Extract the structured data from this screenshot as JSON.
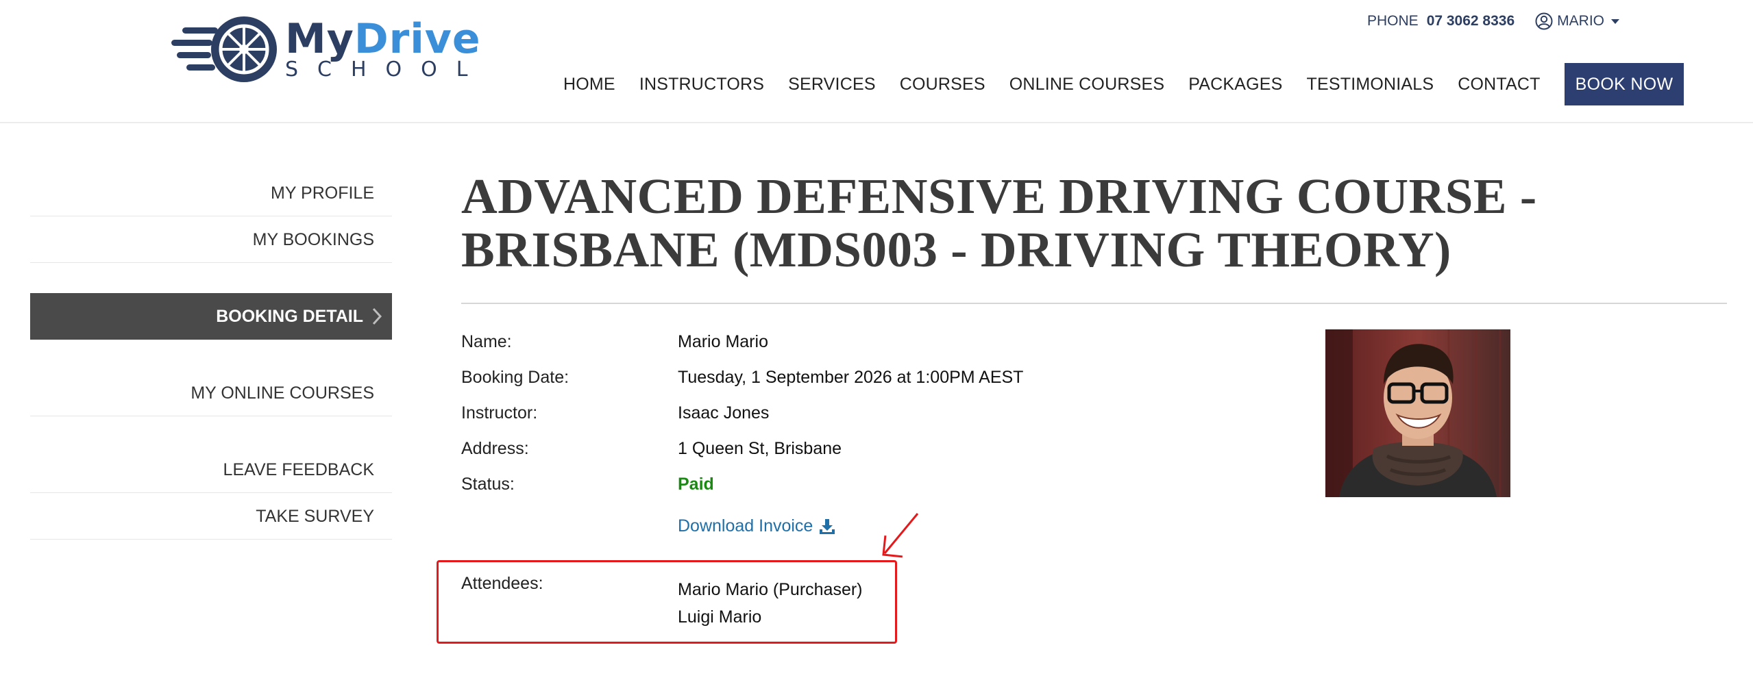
{
  "brand": {
    "name_part1": "My",
    "name_part2": "Drive",
    "tagline": "SCHOOL",
    "colors": {
      "navy": "#2d3e63",
      "blue": "#3a8fd8"
    }
  },
  "topbar": {
    "phone_label": "PHONE",
    "phone_number": "07 3062 8336",
    "user_name": "MARIO",
    "user_icon": "user-circle-icon"
  },
  "nav": {
    "items": [
      "HOME",
      "INSTRUCTORS",
      "SERVICES",
      "COURSES",
      "ONLINE COURSES",
      "PACKAGES",
      "TESTIMONIALS",
      "CONTACT"
    ],
    "cta": "BOOK NOW",
    "cta_color": "#2d3e70"
  },
  "sidebar": {
    "items": [
      "MY PROFILE",
      "MY BOOKINGS"
    ],
    "active": "BOOKING DETAIL",
    "items_after": [
      "MY ONLINE COURSES",
      "LEAVE FEEDBACK",
      "TAKE SURVEY"
    ]
  },
  "booking": {
    "title": "ADVANCED DEFENSIVE DRIVING COURSE - BRISBANE (MDS003 - DRIVING THEORY)",
    "fields": [
      {
        "label": "Name:",
        "value": "Mario Mario"
      },
      {
        "label": "Booking Date:",
        "value": "Tuesday, 1 September 2026 at 1:00PM AEST"
      },
      {
        "label": "Instructor:",
        "value": "Isaac Jones"
      },
      {
        "label": "Address:",
        "value": "1 Queen St, Brisbane"
      },
      {
        "label": "Status:",
        "value": "Paid"
      }
    ],
    "status_color": "#1a8a12",
    "download_invoice": "Download Invoice",
    "attendees_label": "Attendees:",
    "attendees": [
      "Mario Mario (Purchaser)",
      "Luigi Mario"
    ]
  },
  "annotation": {
    "highlight_color": "#e3191c"
  }
}
